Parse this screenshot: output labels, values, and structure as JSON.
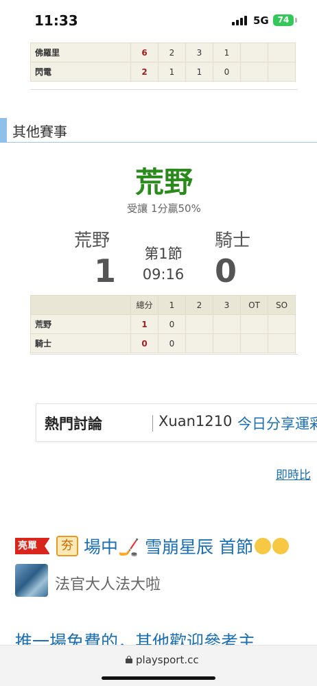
{
  "status_bar": {
    "time": "11:33",
    "network": "5G",
    "battery": "74"
  },
  "previous_game": {
    "rows": [
      {
        "team": "佛羅里",
        "total": "6",
        "p1": "2",
        "p2": "3",
        "p3": "1",
        "ot": "",
        "so": ""
      },
      {
        "team": "閃電",
        "total": "2",
        "p1": "1",
        "p2": "1",
        "p3": "0",
        "ot": "",
        "so": ""
      }
    ]
  },
  "section": {
    "title": "其他賽事"
  },
  "pick": {
    "team": "荒野",
    "line": "受讓 1分贏50%"
  },
  "game": {
    "home_name": "荒野",
    "away_name": "騎士",
    "home_score": "1",
    "away_score": "0",
    "period": "第1節",
    "clock": "09:16",
    "headers": [
      "",
      "總分",
      "1",
      "2",
      "3",
      "OT",
      "SO"
    ],
    "rows": [
      {
        "team": "荒野",
        "total": "1",
        "p1": "0",
        "p2": "",
        "p3": "",
        "ot": "",
        "so": ""
      },
      {
        "team": "騎士",
        "total": "0",
        "p1": "0",
        "p2": "",
        "p3": "",
        "ot": "",
        "so": ""
      }
    ]
  },
  "hot_discussion": {
    "label": "熱門討論",
    "user": "Xuan1210",
    "topic": "今日分享運彩場"
  },
  "live_link": "即時比",
  "post": {
    "badge": "亮單",
    "bet_badge": "夯",
    "title": "場中🏒 雪崩星辰 首節",
    "author": "法官大人法大啦",
    "preview": "推一場免費的，其他歡迎參考主"
  },
  "browser": {
    "url": "playsport.cc"
  },
  "colors": {
    "pick_green": "#2a8a1c",
    "link_blue": "#1b6fb3",
    "score_red": "#a0201c",
    "section_accent": "#8fc0ea"
  }
}
